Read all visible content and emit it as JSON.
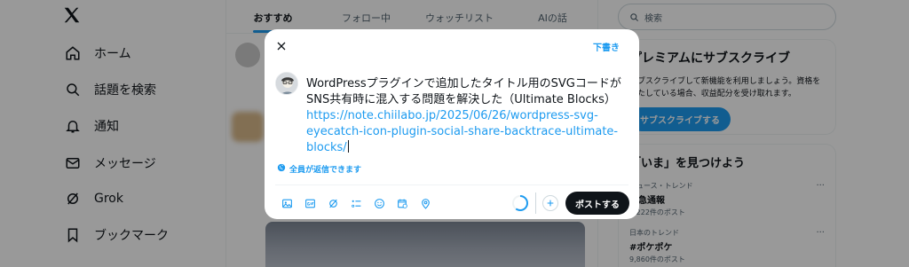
{
  "nav": {
    "items": [
      {
        "label": "ホーム",
        "icon": "home-icon"
      },
      {
        "label": "話題を検索",
        "icon": "search-icon"
      },
      {
        "label": "通知",
        "icon": "bell-icon"
      },
      {
        "label": "メッセージ",
        "icon": "mail-icon"
      },
      {
        "label": "Grok",
        "icon": "grok-icon"
      },
      {
        "label": "ブックマーク",
        "icon": "bookmark-icon"
      }
    ]
  },
  "tabs": [
    "おすすめ",
    "フォロー中",
    "ウォッチリスト",
    "AIの話"
  ],
  "search": {
    "placeholder": "検索"
  },
  "premium": {
    "title": "プレミアムにサブスクライブ",
    "text": "サブスクライブして新機能を利用しましょう。資格を満たしている場合、収益配分を受け取れます。",
    "button": "サブスクライブする"
  },
  "trends": {
    "title": "「いま」を見つけよう",
    "items": [
      {
        "category": "ニュース・トレンド",
        "name": "緊急通報",
        "count": "6,222件のポスト"
      },
      {
        "category": "日本のトレンド",
        "name": "#ポケポケ",
        "count": "9,860件のポスト"
      }
    ]
  },
  "composer": {
    "drafts": "下書き",
    "text_line1": "WordPressプラグインで追加したタイトル用のSVGコードがSNS共有時に混入する問題を解決した（Ultimate Blocks）",
    "link": "https://note.chiilabo.jp/2025/06/26/wordpress-svg-eyecatch-icon-plugin-social-share-backtrace-ultimate-blocks/",
    "reply_setting": "全員が返信できます",
    "post_button": "ポストする",
    "toolbar_icons": [
      "image-icon",
      "gif-icon",
      "grok-icon",
      "poll-icon",
      "emoji-icon",
      "schedule-icon",
      "location-icon"
    ]
  },
  "colors": {
    "accent": "#1d9bf0",
    "text": "#0f1419",
    "muted": "#536471"
  }
}
